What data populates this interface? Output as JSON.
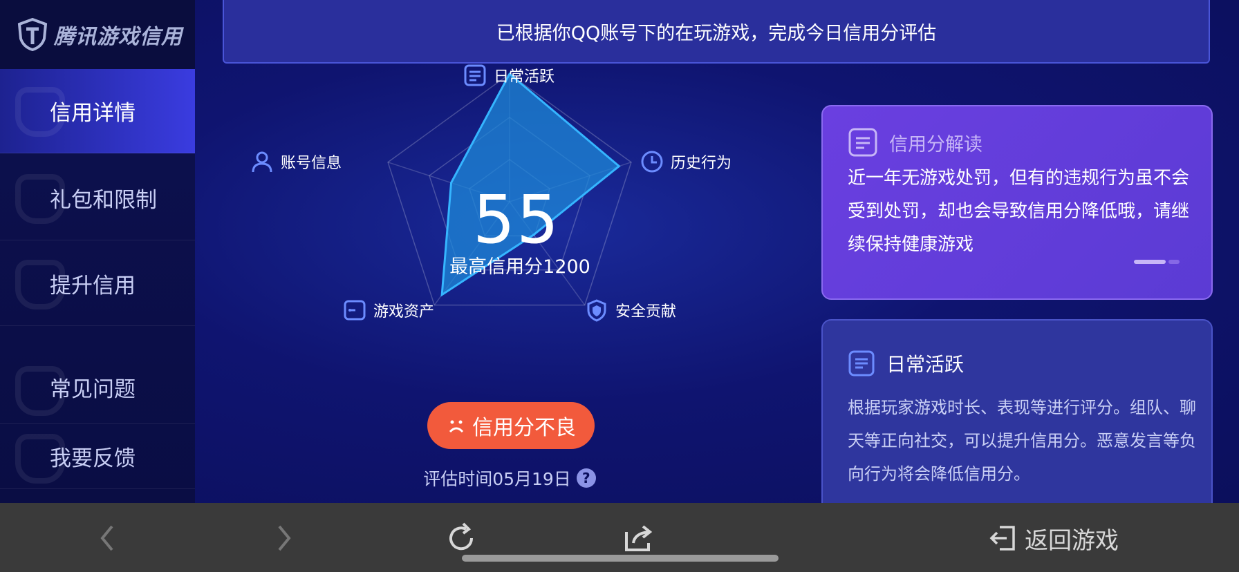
{
  "app": {
    "logo_text": "腾讯游戏信用"
  },
  "sidebar": {
    "items": [
      {
        "label": "信用详情"
      },
      {
        "label": "礼包和限制"
      },
      {
        "label": "提升信用"
      },
      {
        "label": "常见问题"
      },
      {
        "label": "我要反馈"
      }
    ]
  },
  "banner": {
    "text": "已根据你QQ账号下的在玩游戏，完成今日信用分评估"
  },
  "radar": {
    "axes": [
      {
        "label": "日常活跃",
        "icon": "list-icon"
      },
      {
        "label": "历史行为",
        "icon": "clock-icon"
      },
      {
        "label": "安全贡献",
        "icon": "shield-icon"
      },
      {
        "label": "游戏资产",
        "icon": "wallet-icon"
      },
      {
        "label": "账号信息",
        "icon": "user-icon"
      }
    ],
    "values": [
      1.0,
      0.9,
      0.32,
      0.9,
      0.48
    ],
    "score": "55",
    "max_score": "最高信用分1200"
  },
  "status": {
    "label": "信用分不良",
    "icon": "sad-face-icon"
  },
  "eval_time": {
    "label": "评估时间05月19日",
    "help": "?"
  },
  "interpretation": {
    "title": "信用分解读",
    "body": "近一年无游戏处罚，但有的违规行为虽不会受到处罚，却也会导致信用分降低哦，请继续保持健康游戏"
  },
  "daily": {
    "title": "日常活跃",
    "body": "根据玩家游戏时长、表现等进行评分。组队、聊天等正向社交，可以提升信用分。恶意发言等负向行为将会降低信用分。"
  },
  "bottombar": {
    "back_game_label": "返回游戏"
  },
  "colors": {
    "accent": "#3a3ce0",
    "status_bad": "#f25a3c",
    "radar_fill": "#1e88d8",
    "radar_stroke": "#35b5ff"
  }
}
